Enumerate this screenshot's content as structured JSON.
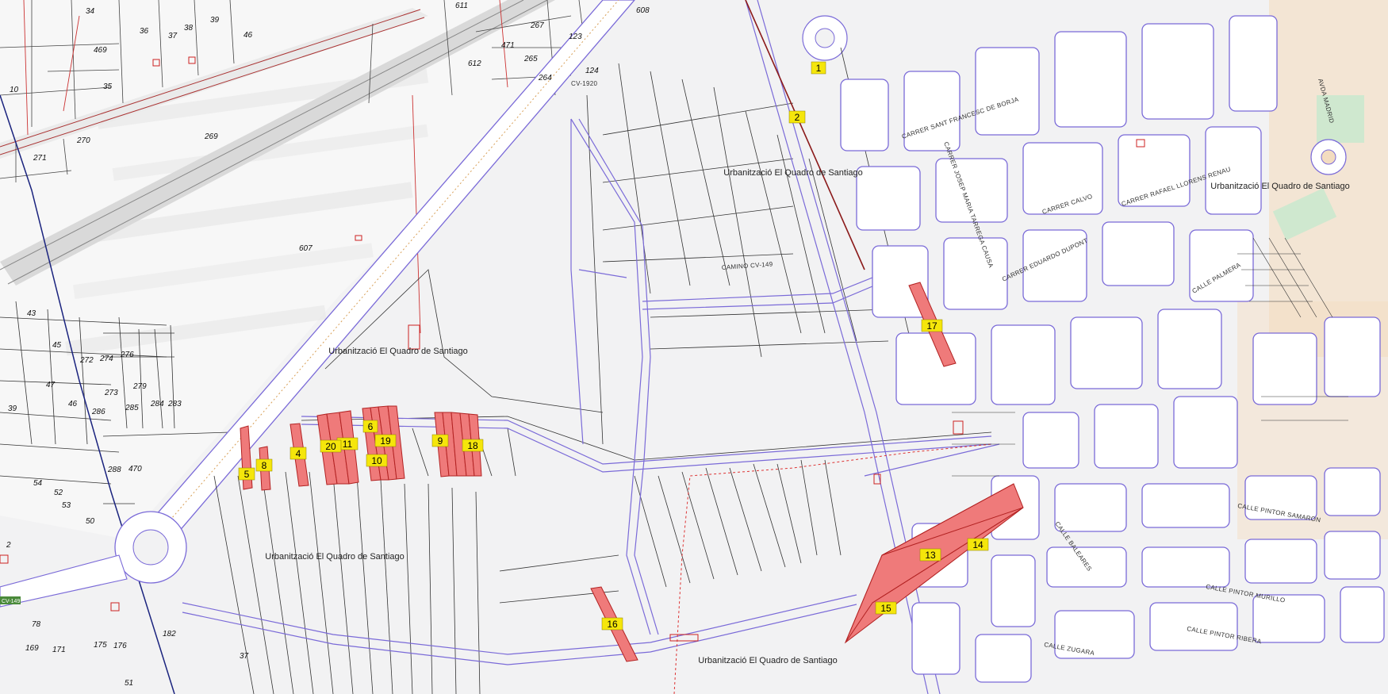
{
  "map": {
    "colors": {
      "background": "#f2f2f3",
      "cadastre_left": "#fafafa",
      "parcel_line": "#2b2b2b",
      "road_line": "#6a5acd",
      "road_fill": "#ffffff",
      "highlight_fill": "#ef7a7a",
      "highlight_stroke": "#b22222",
      "tag_fill": "#f5e60b",
      "urban_fill": "#f3dcc0"
    },
    "numbered_parcels": [
      "1",
      "2",
      "4",
      "5",
      "6",
      "8",
      "9",
      "10",
      "11",
      "13",
      "14",
      "15",
      "16",
      "17",
      "18",
      "19",
      "20"
    ],
    "area_labels": [
      "Urbanització El Quadro de Santiago",
      "Urbanització El Quadro de Santiago",
      "Urbanització El Quadro de Santiago",
      "Urbanització El Quadro de Santiago",
      "Urbanització El Quadro de Santiago"
    ],
    "cadastral_numbers": [
      "34",
      "36",
      "37",
      "38",
      "39",
      "46",
      "469",
      "35",
      "10",
      "271",
      "270",
      "269",
      "607",
      "611",
      "608",
      "267",
      "123",
      "471",
      "265",
      "264",
      "124",
      "612",
      "43",
      "45",
      "47",
      "39",
      "46",
      "273",
      "279",
      "285",
      "284",
      "283",
      "286",
      "288",
      "470",
      "54",
      "52",
      "53",
      "50",
      "2",
      "78",
      "182",
      "169",
      "171",
      "176",
      "175",
      "37",
      "51",
      "272",
      "274",
      "276"
    ],
    "street_labels": [
      "CARRER SANT FRANCESC DE BORJA",
      "CARRER JOSEP MARIA TARREGA CAUSA",
      "CARRER RAFAEL LLORENS RENAU",
      "CARRER EDUARDO DUPONT",
      "CARRER CALVO",
      "CALLE PALMERA",
      "CALLE PINTOR SAMARON",
      "CALLE PINTOR MURILLO",
      "CALLE ZUGARA",
      "CALLE BALEARES",
      "CALLE PINTOR RIBERA",
      "CAMINO CV-149",
      "AVDA MADRID",
      "CV-1920"
    ],
    "road_codes": [
      "CV-149"
    ]
  }
}
